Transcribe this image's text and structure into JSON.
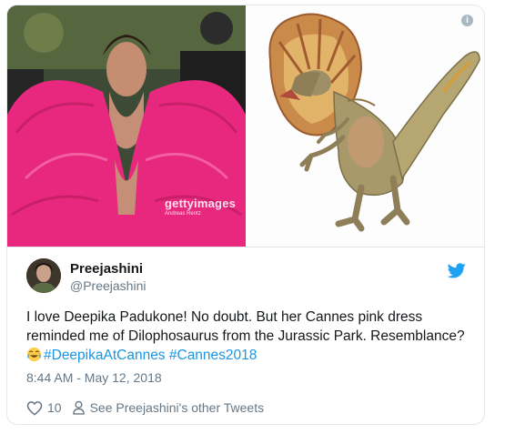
{
  "media": {
    "watermark_brand": "gettyimages",
    "watermark_credit": "Andreas Rentz",
    "info_icon": "i"
  },
  "author": {
    "name": "Preejashini",
    "handle": "@Preejashini"
  },
  "tweet": {
    "text_part1": "I love Deepika Padukone! No doubt. But her Cannes pink dress reminded me of Dilophosaurus from the Jurassic Park. Resemblance? ",
    "emoji": "face-with-tears-of-joy",
    "hashtag1": "#DeepikaAtCannes",
    "hashtag2": "#Cannes2018",
    "timestamp": "8:44 AM - May 12, 2018"
  },
  "actions": {
    "like_count": "10",
    "see_others_label": "See Preejashini's other Tweets"
  },
  "colors": {
    "link": "#1b95e0",
    "text": "#14171a",
    "muted": "#657786",
    "brand": "#1da1f2",
    "dress": "#e8287e"
  }
}
